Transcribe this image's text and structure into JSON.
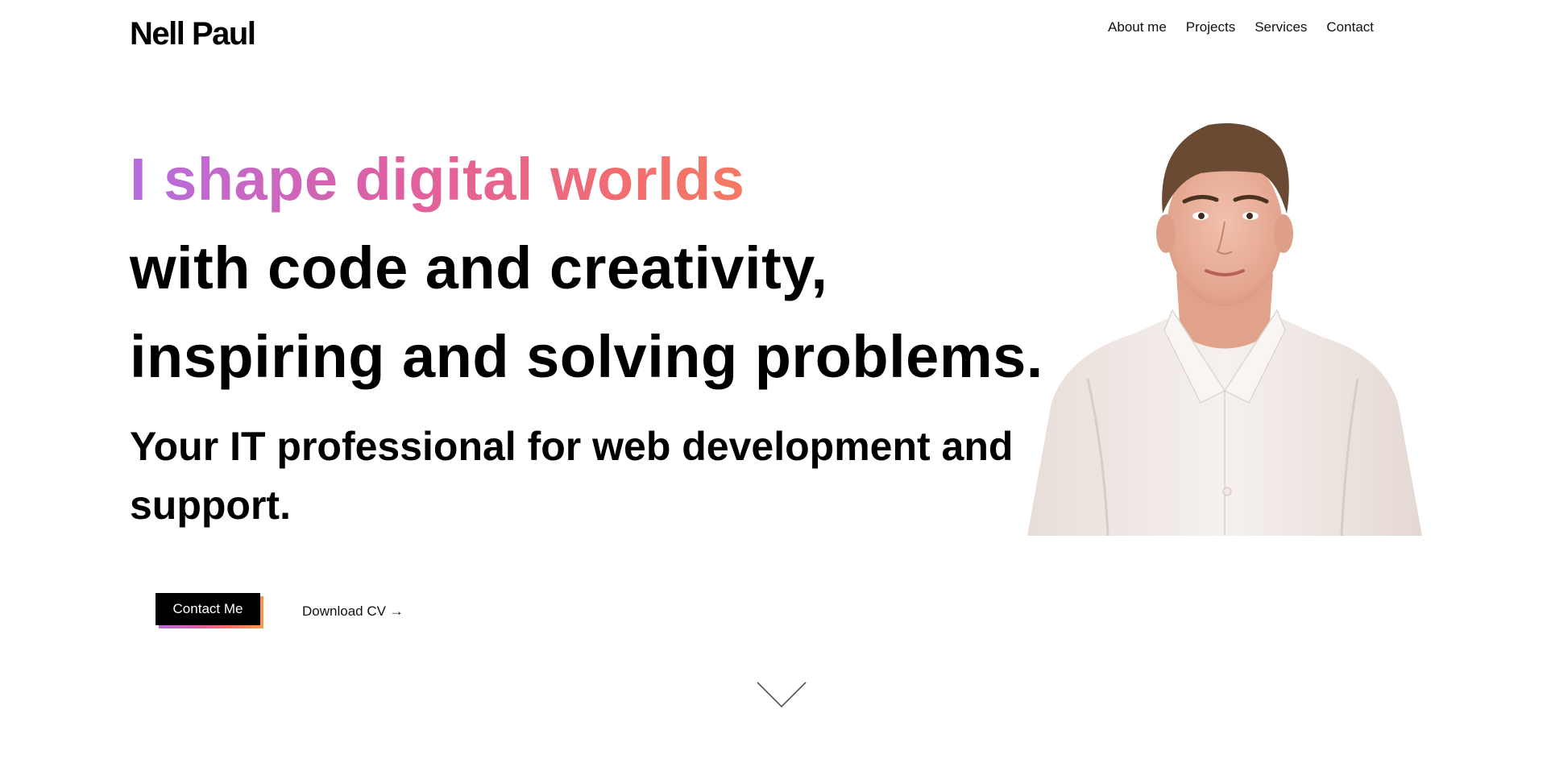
{
  "header": {
    "logo": "Nell Paul",
    "nav": [
      "About me",
      "Projects",
      "Services",
      "Contact"
    ]
  },
  "hero": {
    "headline_gradient": "I shape digital worlds",
    "headline_line2": "with code and creativity,",
    "headline_line3": "inspiring and solving problems.",
    "subline": "Your IT professional for web development and support."
  },
  "actions": {
    "contact_label": "Contact Me",
    "download_label": "Download CV →"
  },
  "icons": {
    "scroll": "chevron-down-icon",
    "portrait": "portrait-photo"
  },
  "colors": {
    "gradient_start": "#b56de0",
    "gradient_mid": "#f36e6e",
    "gradient_end": "#f89a4a",
    "button_bg": "#000000"
  }
}
